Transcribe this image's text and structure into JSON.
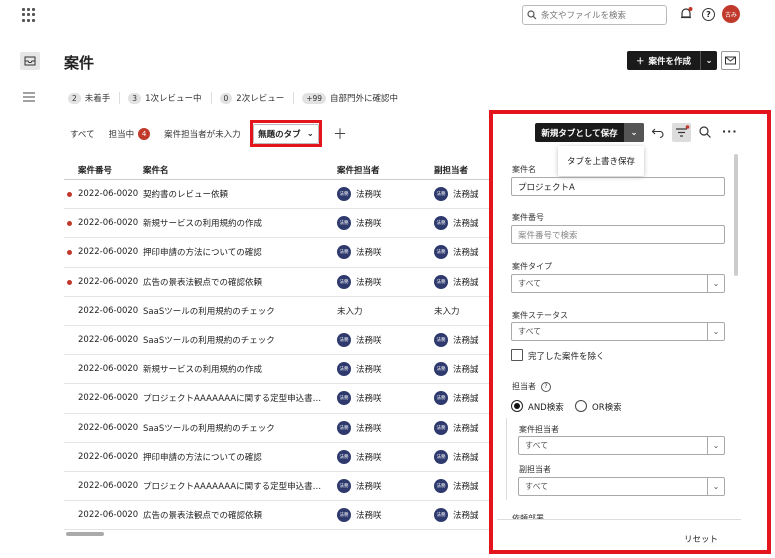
{
  "topbar": {
    "search_placeholder": "条文やファイルを検索",
    "avatar_text": "古み"
  },
  "header": {
    "title": "案件",
    "create_label": "案件を作成"
  },
  "status_chips": [
    {
      "count": "2",
      "label": "未着手"
    },
    {
      "count": "3",
      "label": "1次レビュー中"
    },
    {
      "count": "0",
      "label": "2次レビュー"
    },
    {
      "count": "+99",
      "label": "自部門外に確認中"
    }
  ],
  "tabs": {
    "all": "すべて",
    "assigned": "担当中",
    "assigned_badge": "4",
    "unassigned": "案件担当者が未入力",
    "untitled": "無題のタブ"
  },
  "table": {
    "headers": [
      "案件番号",
      "案件名",
      "案件担当者",
      "副担当者"
    ],
    "avatar_text": "法務",
    "rows": [
      {
        "dot": true,
        "id": "2022-06-0020",
        "name": "契約書のレビュー依頼",
        "owner": "法務咲",
        "sub": "法務誠"
      },
      {
        "dot": true,
        "id": "2022-06-0020",
        "name": "新規サービスの利用規約の作成",
        "owner": "法務咲",
        "sub": "法務誠"
      },
      {
        "dot": true,
        "id": "2022-06-0020",
        "name": "押印申請の方法についての確認",
        "owner": "法務咲",
        "sub": "法務誠"
      },
      {
        "dot": true,
        "id": "2022-06-0020",
        "name": "広告の景表法観点での確認依頼",
        "owner": "法務咲",
        "sub": "法務誠"
      },
      {
        "dot": false,
        "id": "2022-06-0020",
        "name": "SaaSツールの利用規約のチェック",
        "owner": "未入力",
        "sub": "未入力"
      },
      {
        "dot": false,
        "id": "2022-06-0020",
        "name": "SaaSツールの利用規約のチェック",
        "owner": "法務咲",
        "sub": "法務誠"
      },
      {
        "dot": false,
        "id": "2022-06-0020",
        "name": "新規サービスの利用規約の作成",
        "owner": "法務咲",
        "sub": "法務誠"
      },
      {
        "dot": false,
        "id": "2022-06-0020",
        "name": "プロジェクトAAAAAAAに関する定型申込書…",
        "owner": "法務咲",
        "sub": "法務誠"
      },
      {
        "dot": false,
        "id": "2022-06-0020",
        "name": "SaaSツールの利用規約のチェック",
        "owner": "法務咲",
        "sub": "法務誠"
      },
      {
        "dot": false,
        "id": "2022-06-0020",
        "name": "押印申請の方法についての確認",
        "owner": "法務咲",
        "sub": "法務誠"
      },
      {
        "dot": false,
        "id": "2022-06-0020",
        "name": "プロジェクトAAAAAAAに関する定型申込書…",
        "owner": "法務咲",
        "sub": "法務誠"
      },
      {
        "dot": false,
        "id": "2022-06-0020",
        "name": "広告の景表法観点での確認依頼",
        "owner": "法務咲",
        "sub": "法務誠"
      }
    ]
  },
  "panel": {
    "save_label": "新規タブとして保存",
    "tooltip": "タブを上書き保存",
    "name_label": "案件名",
    "name_value": "プロジェクトA",
    "number_label": "案件番号",
    "number_placeholder": "案件番号で検索",
    "type_label": "案件タイプ",
    "type_value": "すべて",
    "status_label": "案件ステータス",
    "status_value": "すべて",
    "exclude_label": "完了した案件を除く",
    "assignee_label": "担当者",
    "and_label": "AND検索",
    "or_label": "OR検索",
    "owner_label": "案件担当者",
    "owner_value": "すべて",
    "sub_label": "副担当者",
    "sub_value": "すべて",
    "dept_label": "依頼部署",
    "reset_label": "リセット"
  },
  "colors": {
    "highlight": "#e4141c",
    "badge": "#c0392b",
    "primary_button": "#1a1a1a"
  }
}
